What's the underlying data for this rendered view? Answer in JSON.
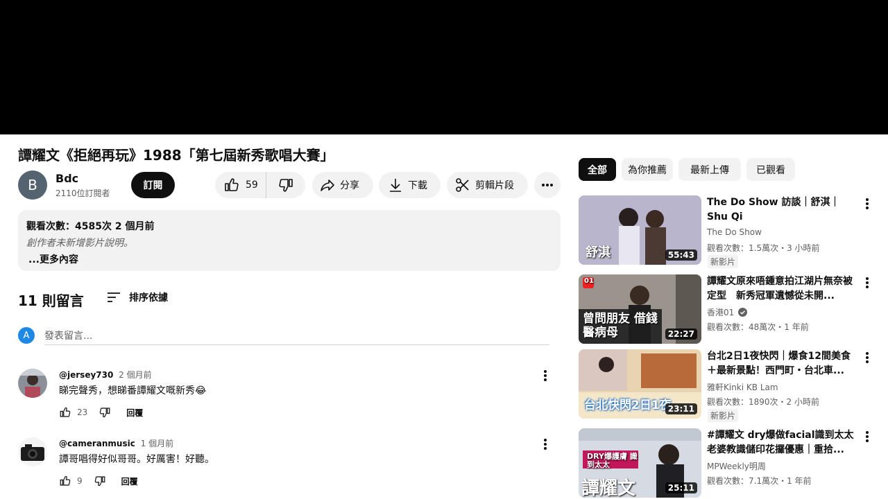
{
  "video": {
    "title": "譚耀文《拒絕再玩》1988「第七屆新秀歌唱大賽」",
    "channel": {
      "initial": "B",
      "name": "Bdc",
      "subscribers": "2110位訂閱者",
      "subscribe_label": "訂閱"
    },
    "actions": {
      "likes": "59",
      "share": "分享",
      "download": "下載",
      "clip": "剪輯片段"
    },
    "description": {
      "stats": "觀看次數：4585次  2 個月前",
      "text": "創作者未新增影片說明。",
      "more": "...更多內容"
    }
  },
  "comments": {
    "count_label": "11 則留言",
    "sort_label": "排序依據",
    "my_initial": "A",
    "input_placeholder": "發表留言...",
    "items": [
      {
        "author": "@jersey730",
        "time": "2 個月前",
        "text": "睇完聲秀，想睇番譚耀文嘅新秀😂",
        "likes": "23",
        "reply": "回覆"
      },
      {
        "author": "@cameranmusic",
        "time": "1 個月前",
        "text": "譚哥唱得好似哥哥。好厲害！好聽。",
        "likes": "9",
        "reply": "回覆"
      }
    ]
  },
  "chips": [
    "全部",
    "為你推薦",
    "最新上傳",
    "已觀看"
  ],
  "recommendations": [
    {
      "title": "The Do Show 訪談｜舒淇｜Shu Qi",
      "channel": "The Do Show",
      "stats": "觀看次數：1.5萬次・3 小時前",
      "badge": "新影片",
      "duration": "55:43",
      "thumb_text": "舒淇"
    },
    {
      "title": "譚耀文原來唔鍾意拍江湖片無奈被定型　新秀冠軍遺憾從未開...",
      "channel": "香港01",
      "stats": "觀看次數：48萬次・1 年前",
      "duration": "22:27",
      "thumb_text": "曾問朋友 借錢醫病母",
      "thumb_logo": "01"
    },
    {
      "title": "台北2日1夜快閃｜爆食12間美食＋最新景點！西門町・台北車...",
      "channel": "雅軒Kinki KB Lam",
      "stats": "觀看次數：1890次・2 小時前",
      "badge": "新影片",
      "duration": "23:11",
      "thumb_text": "台北快閃2日1夜"
    },
    {
      "title": "#譚耀文 dry爆做facial識到太太 老婆教識儲印花攞優惠｜重拾...",
      "channel": "MPWeekly明周",
      "stats": "觀看次數：7.1萬次・1 年前",
      "duration": "25:11",
      "thumb_text": "DRY爆護膚 識到太太",
      "thumb_text2": "譚耀文"
    }
  ],
  "colors": {
    "accent_dark": "#0f0f0f",
    "chip_bg": "#f2f2f2",
    "secondary_text": "#606060"
  }
}
